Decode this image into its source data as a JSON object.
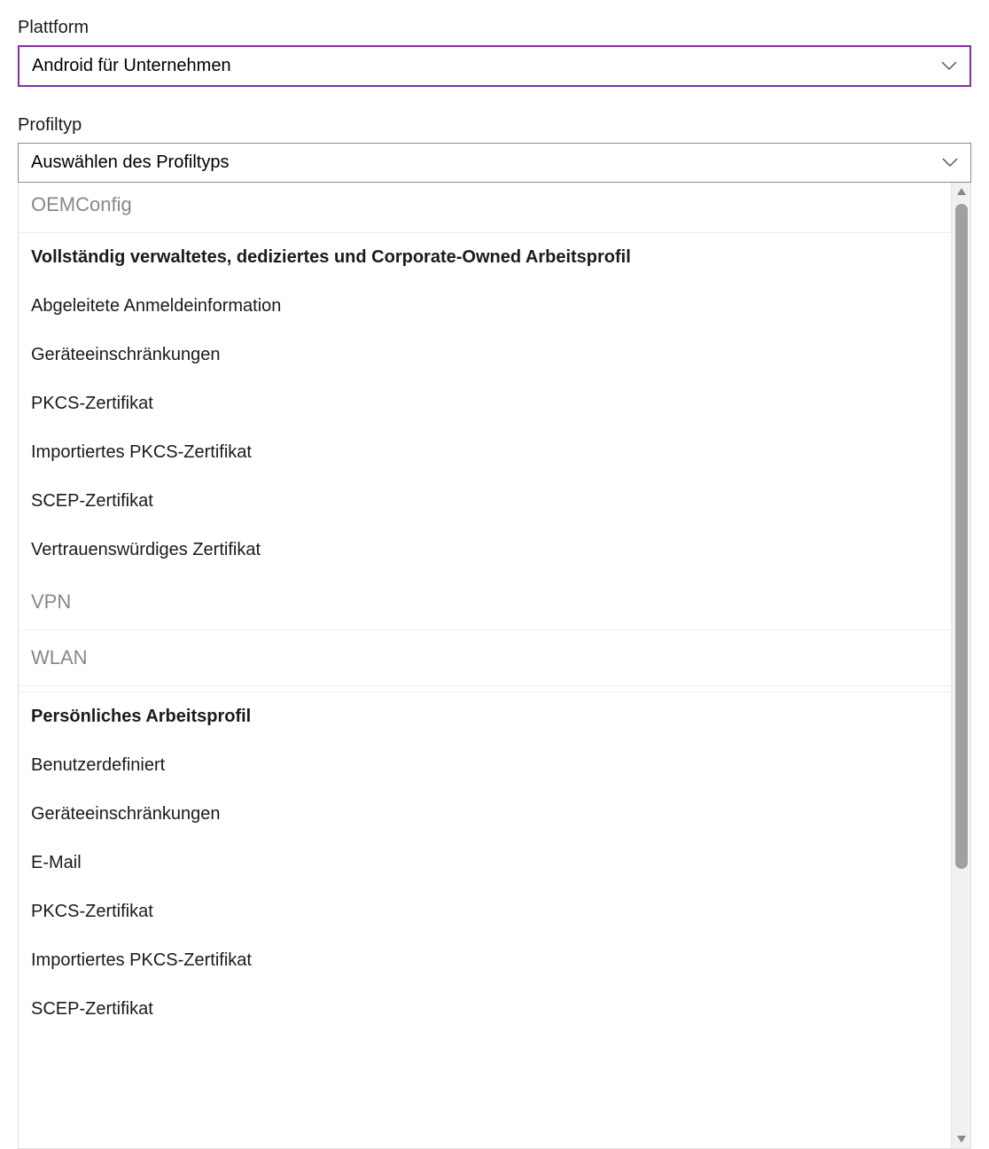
{
  "platform": {
    "label": "Plattform",
    "value": "Android für Unternehmen"
  },
  "profileType": {
    "label": "Profiltyp",
    "placeholder": "Auswählen des Profiltyps"
  },
  "dropdown": {
    "group1": {
      "header": "OEMConfig",
      "subheaderBold": "Vollständig verwaltetes, dediziertes und Corporate-Owned Arbeitsprofil",
      "items": {
        "0": "Abgeleitete Anmeldeinformation",
        "1": "Geräteeinschränkungen",
        "2": "PKCS-Zertifikat",
        "3": "Importiertes PKCS-Zertifikat",
        "4": "SCEP-Zertifikat",
        "5": "Vertrauenswürdiges Zertifikat"
      },
      "vpnHeader": "VPN",
      "wlanHeader": "WLAN"
    },
    "group2": {
      "subheaderBold": "Persönliches Arbeitsprofil",
      "items": {
        "0": "Benutzerdefiniert",
        "1": "Geräteeinschränkungen",
        "2": "E-Mail",
        "3": "PKCS-Zertifikat",
        "4": "Importiertes PKCS-Zertifikat",
        "5": "SCEP-Zertifikat"
      }
    }
  }
}
